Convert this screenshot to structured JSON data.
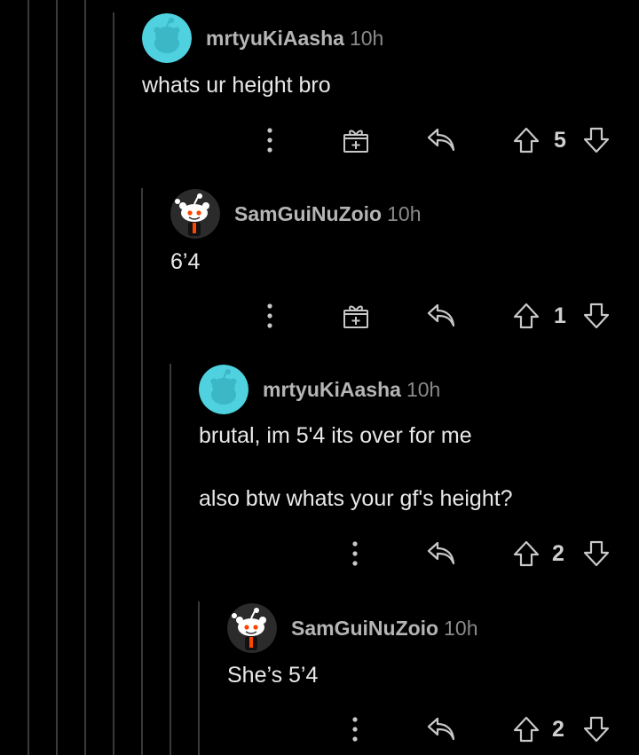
{
  "comments": [
    {
      "username": "mrtyuKiAasha",
      "timestamp": "10h",
      "avatar_icon": "snoo-teal-avatar-icon",
      "lines": [
        "whats ur height bro"
      ],
      "votes": "5",
      "has_award": true
    },
    {
      "username": "SamGuiNuZoio",
      "timestamp": "10h",
      "avatar_icon": "snoo-default-avatar-icon",
      "lines": [
        "6’4"
      ],
      "votes": "1",
      "has_award": true
    },
    {
      "username": "mrtyuKiAasha",
      "timestamp": "10h",
      "avatar_icon": "snoo-teal-avatar-icon",
      "lines": [
        "brutal, im 5'4 its over for me",
        "also btw whats your gf's height?"
      ],
      "votes": "2",
      "has_award": false
    },
    {
      "username": "SamGuiNuZoio",
      "timestamp": "10h",
      "avatar_icon": "snoo-default-avatar-icon",
      "lines": [
        "She’s 5’4"
      ],
      "votes": "2",
      "has_award": false
    }
  ],
  "icons": {
    "more": "more-options-icon",
    "award": "award-gift-icon",
    "reply": "reply-arrow-icon",
    "upvote": "upvote-arrow-icon",
    "downvote": "downvote-arrow-icon"
  },
  "colors": {
    "background": "#000000",
    "teal_avatar": "#4fd1e0",
    "thread_line": "#3a3a3a",
    "icon": "#c8c8c8"
  }
}
